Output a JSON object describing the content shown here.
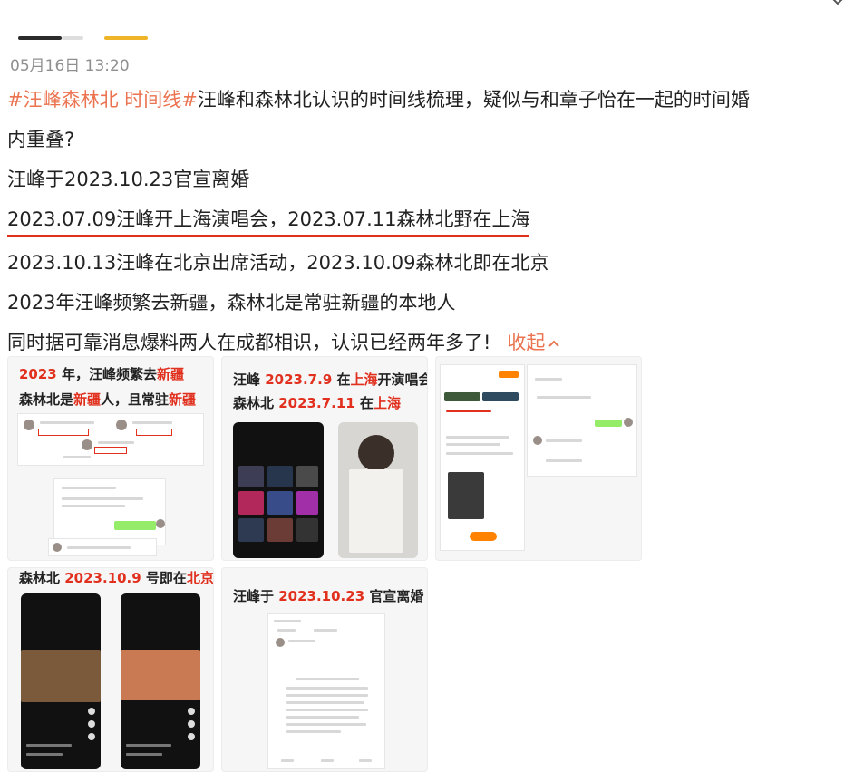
{
  "header": {
    "timestamp": "05月16日 13:20"
  },
  "post": {
    "topic": "#汪峰森林北 时间线#",
    "line1_rest": "汪峰和森林北认识的时间线梳理，疑似与和章子怡在一起的时间婚",
    "line2": "内重叠?",
    "line3": "汪峰于2023.10.23官宣离婚",
    "line4": "2023.07.09汪峰开上海演唱会，2023.07.11森林北野在上海",
    "line5": "2023.10.13汪峰在北京出席活动，2023.10.09森林北即在北京",
    "line6": "2023年汪峰频繁去新疆，森林北是常驻新疆的本地人",
    "line7": "同时据可靠消息爆料两人在成都相识，认识已经两年多了!",
    "collapse_label": "收起"
  },
  "images": {
    "img1": {
      "cap1_a": "2023",
      "cap1_b": " 年，汪峰频繁去",
      "cap1_c": "新疆",
      "cap2_a": "森林北是",
      "cap2_b": "新疆",
      "cap2_c": "人，且常驻",
      "cap2_d": "新疆"
    },
    "img2": {
      "cap1_a": "汪峰 ",
      "cap1_b": "2023.7.9",
      "cap1_c": " 在",
      "cap1_d": "上海",
      "cap1_e": "开演唱会",
      "cap2_a": "森林北 ",
      "cap2_b": "2023.7.11",
      "cap2_c": " 在",
      "cap2_d": "上海"
    },
    "img4": {
      "cap_a": "森林北 ",
      "cap_b": "2023.10.9",
      "cap_c": " 号即在",
      "cap_d": "北京"
    },
    "img5": {
      "cap_a": "汪峰于 ",
      "cap_b": "2023.10.23",
      "cap_c": " 官宣离婚"
    }
  },
  "colors": {
    "topic": "#eb7350",
    "highlight_red": "#e1301e",
    "tab_active": "#2b2b2b",
    "tab_accent": "#f0b429"
  },
  "icons": [
    "chevron-down-icon",
    "chevron-up-icon"
  ]
}
